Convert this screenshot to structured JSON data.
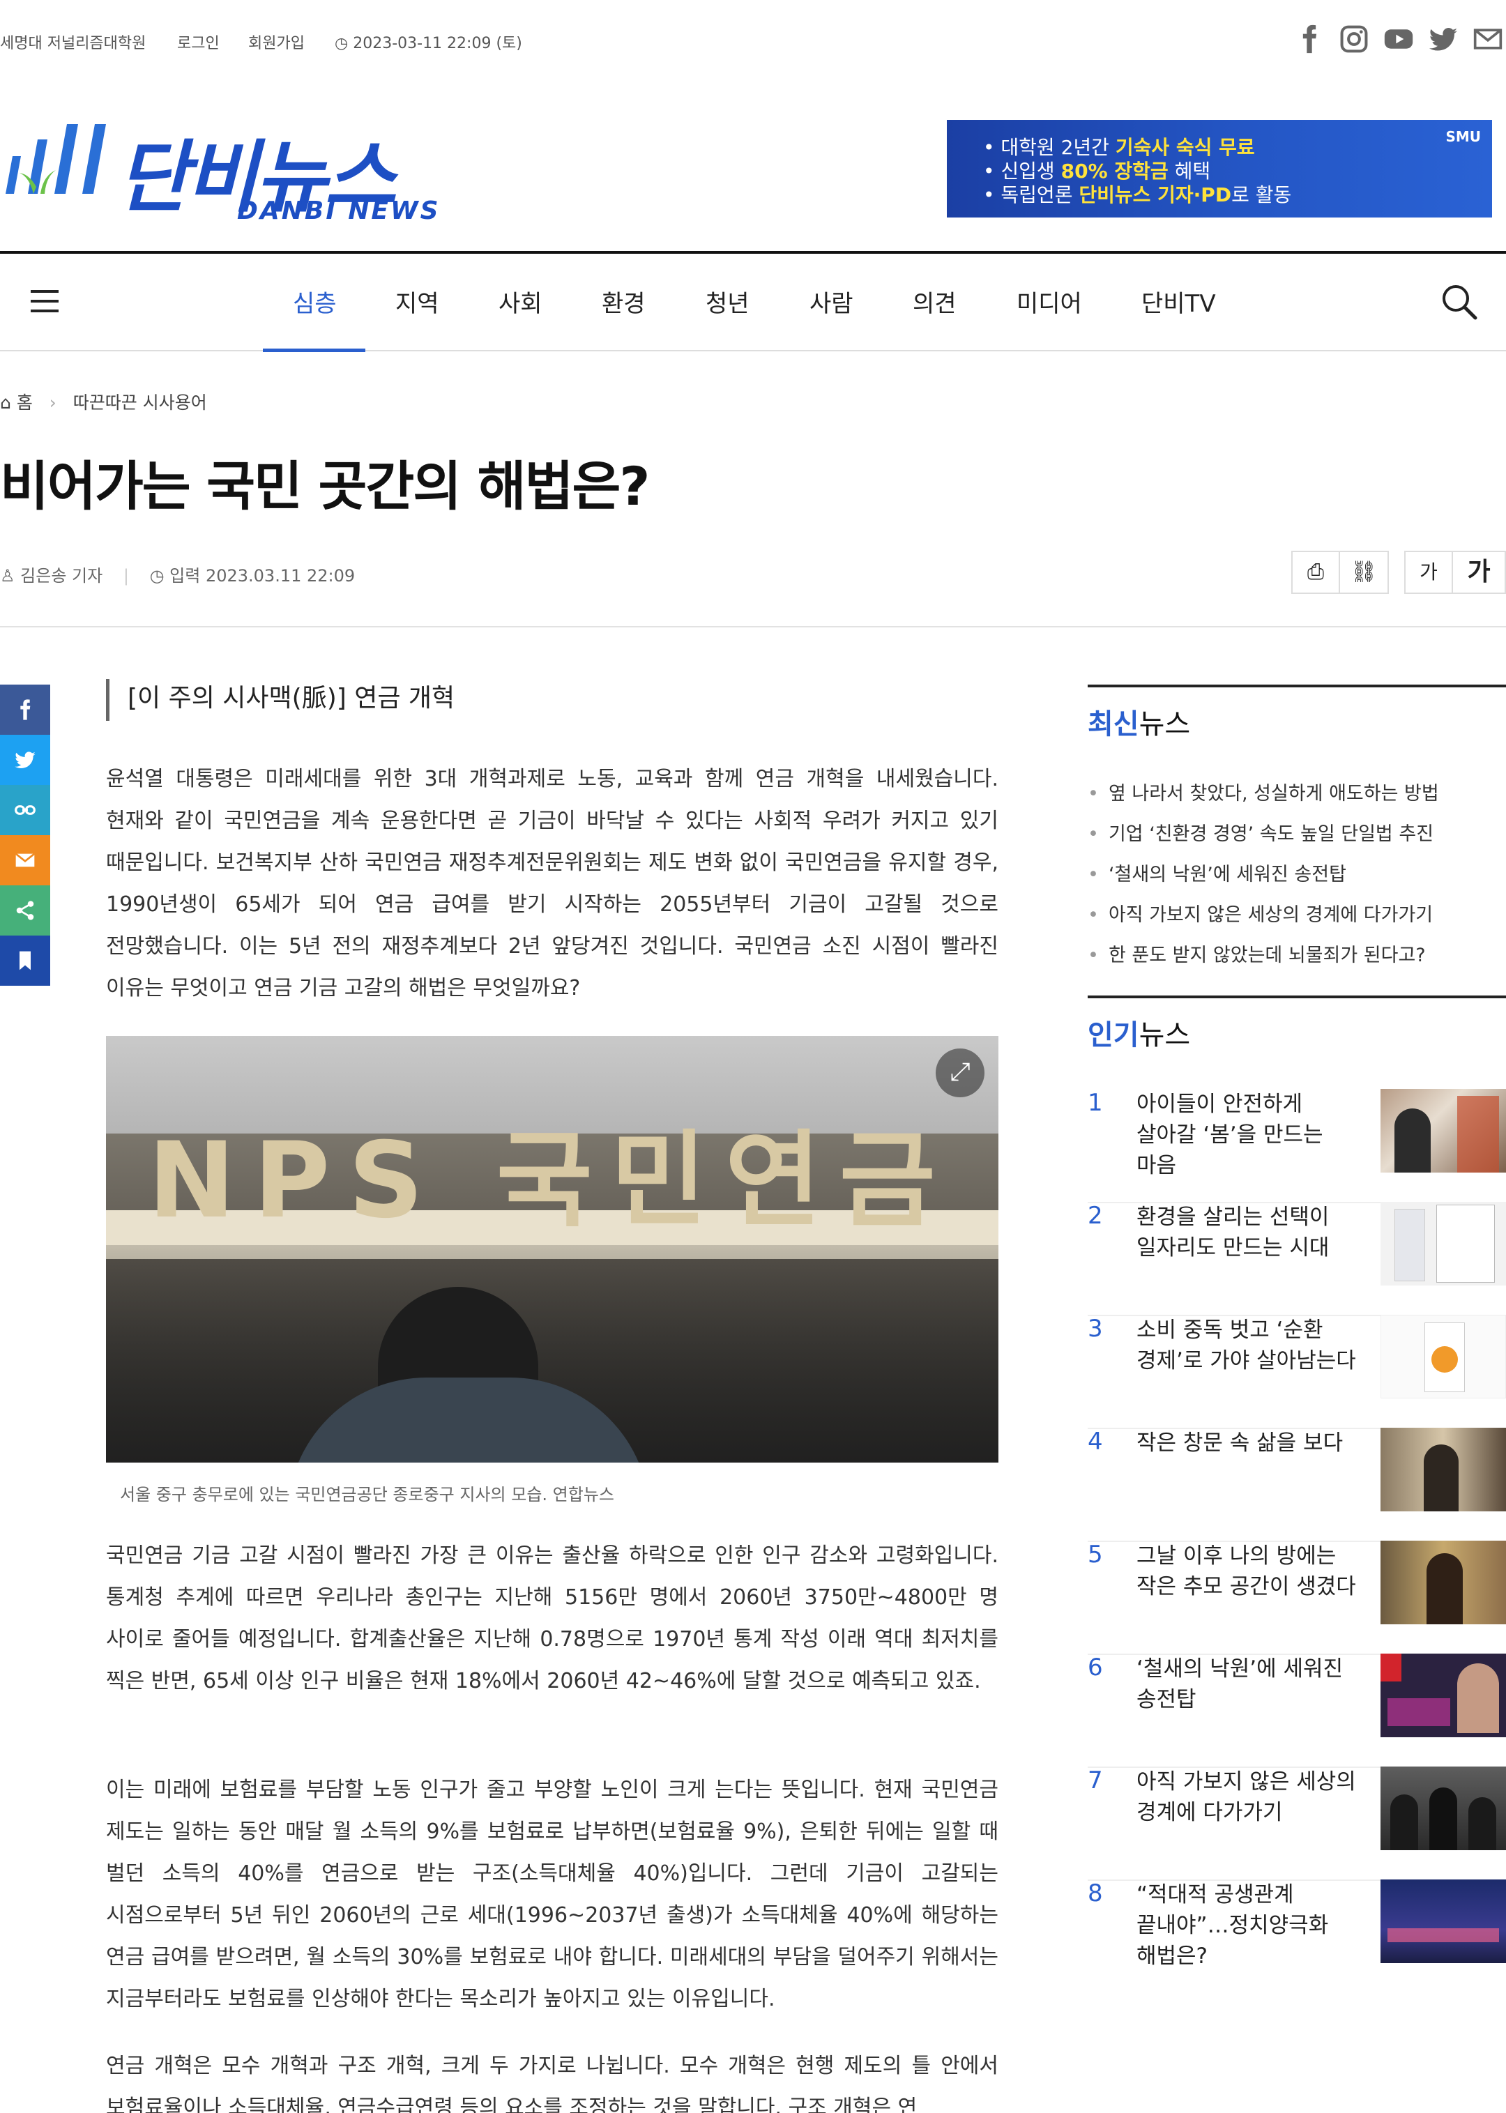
{
  "topbar": {
    "site": "세명대 저널리즘대학원",
    "login": "로그인",
    "signup": "회원가입",
    "datetime": "2023-03-11 22:09 (토)"
  },
  "logo": {
    "main": "단비뉴스",
    "sub": "DANBI NEWS"
  },
  "banner": {
    "line1_pre": "• 대학원 2년간 ",
    "line1_hl": "기숙사 숙식 무료",
    "line2_pre": "• 신입생 ",
    "line2_hl": "80% 장학금",
    "line2_post": " 혜택",
    "line3_pre": "• 독립언론 ",
    "line3_hl": "단비뉴스 기자·PD",
    "line3_post": "로 활동",
    "brand": "SMU"
  },
  "nav": {
    "items": [
      "심층",
      "지역",
      "사회",
      "환경",
      "청년",
      "사람",
      "의견",
      "미디어",
      "단비TV"
    ],
    "active_index": 0
  },
  "breadcrumb": {
    "home": "홈",
    "section": "따끈따끈 시사용어"
  },
  "article": {
    "title": "비어가는 국민 곳간의 해법은?",
    "author": "김은송 기자",
    "input": "입력 2023.03.11 22:09",
    "font_small": "가",
    "font_large": "가",
    "subhead": "[이 주의 시사맥(脈)] 연금 개혁",
    "para1": "윤석열 대통령은 미래세대를 위한 3대 개혁과제로 노동, 교육과 함께 연금 개혁을 내세웠습니다. 현재와 같이 국민연금을 계속 운용한다면 곧 기금이 바닥날 수 있다는 사회적 우려가 커지고 있기 때문입니다. 보건복지부 산하 국민연금 재정추계전문위원회는 제도 변화 없이 국민연금을 유지할 경우, 1990년생이 65세가 되어 연금 급여를 받기 시작하는 2055년부터 기금이 고갈될 것으로 전망했습니다. 이는 5년 전의 재정추계보다 2년 앞당겨진 것입니다. 국민연금 소진 시점이 빨라진 이유는 무엇이고 연금 기금 고갈의 해법은 무엇일까요?",
    "photo_sign": "NPS 국민연금",
    "caption": "서울 중구 충무로에 있는 국민연금공단 종로중구 지사의 모습. 연합뉴스",
    "para2": "국민연금 기금 고갈 시점이 빨라진 가장 큰 이유는 출산율 하락으로 인한 인구 감소와 고령화입니다. 통계청 추계에 따르면 우리나라 총인구는 지난해 5156만 명에서 2060년 3750만~4800만 명 사이로 줄어들 예정입니다. 합계출산율은 지난해 0.78명으로 1970년 통계 작성 이래 역대 최저치를 찍은 반면, 65세 이상 인구 비율은 현재 18%에서 2060년 42~46%에 달할 것으로 예측되고 있죠.",
    "para3": "이는 미래에 보험료를 부담할 노동 인구가 줄고 부양할 노인이 크게 는다는 뜻입니다. 현재 국민연금 제도는 일하는 동안 매달 월 소득의 9%를 보험료로 납부하면(보험료율 9%), 은퇴한 뒤에는 일할 때 벌던 소득의 40%를 연금으로 받는 구조(소득대체율 40%)입니다. 그런데 기금이 고갈되는 시점으로부터 5년 뒤인 2060년의 근로 세대(1996~2037년 출생)가 소득대체율 40%에 해당하는 연금 급여를 받으려면, 월 소득의 30%를 보험료로 내야 합니다. 미래세대의 부담을 덜어주기 위해서는 지금부터라도 보험료를 인상해야 한다는 목소리가 높아지고 있는 이유입니다.",
    "para4": "연금 개혁은 모수 개혁과 구조 개혁, 크게 두 가지로 나뉩니다. 모수 개혁은 현행 제도의 틀 안에서 보험료율이나 소득대체율, 연금수급연령 등의 요소를 조정하는 것을 말합니다. 구조 개혁은 연"
  },
  "sidebar": {
    "latest_title_b": "최신",
    "latest_title_r": "뉴스",
    "latest": [
      "옆 나라서 찾았다, 성실하게 애도하는 방법",
      "기업 ‘친환경 경영’ 속도 높일 단일법 추진",
      "‘철새의 낙원’에 세워진 송전탑",
      "아직 가보지 않은 세상의 경계에 다가가기",
      "한 푼도 받지 않았는데 뇌물죄가 된다고?"
    ],
    "popular_title_b": "인기",
    "popular_title_r": "뉴스",
    "popular": [
      {
        "num": "1",
        "title": "아이들이 안전하게 살아갈 ‘봄’을 만드는 마음"
      },
      {
        "num": "2",
        "title": "환경을 살리는 선택이 일자리도 만드는 시대"
      },
      {
        "num": "3",
        "title": "소비 중독 벗고 ‘순환 경제’로 가야 살아남는다"
      },
      {
        "num": "4",
        "title": "작은 창문 속 삶을 보다"
      },
      {
        "num": "5",
        "title": "그날 이후 나의 방에는 작은 추모 공간이 생겼다"
      },
      {
        "num": "6",
        "title": "‘철새의 낙원’에 세워진 송전탑"
      },
      {
        "num": "7",
        "title": "아직 가보지 않은 세상의 경계에 다가가기"
      },
      {
        "num": "8",
        "title": "“적대적 공생관계 끝내야”…정치양극화 해법은?"
      }
    ]
  },
  "colors": {
    "accent": "#2a5fce",
    "facebook": "#3b5998",
    "twitter": "#1da1f2",
    "link": "#29a3c9",
    "email": "#f18a1f",
    "share": "#46b07a",
    "bookmark": "#1e4aa8"
  }
}
